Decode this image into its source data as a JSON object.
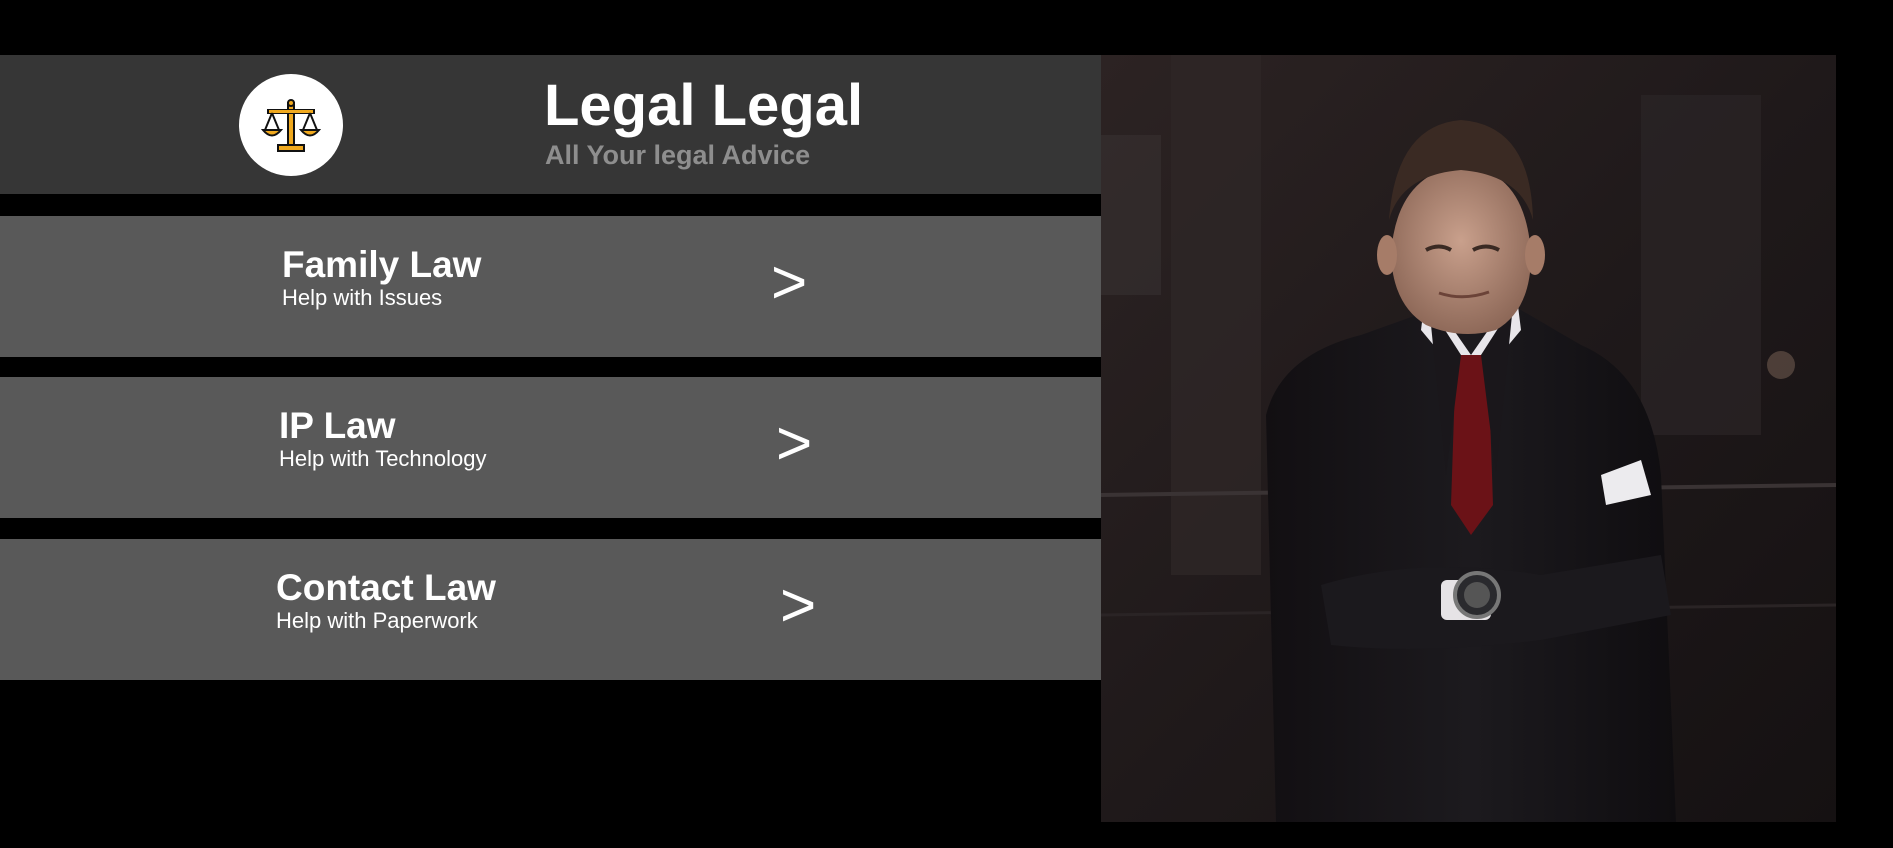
{
  "header": {
    "logo_icon": "scales-of-justice-icon",
    "title": "Legal Legal",
    "subtitle": "All Your legal Advice"
  },
  "services": [
    {
      "title": "Family Law",
      "subtitle": "Help with Issues",
      "arrow": ">"
    },
    {
      "title": "IP Law",
      "subtitle": "Help with Technology",
      "arrow": ">"
    },
    {
      "title": "Contact Law",
      "subtitle": "Help with Paperwork",
      "arrow": ">"
    }
  ],
  "hero_image": {
    "subject": "man-in-suit-photo"
  },
  "colors": {
    "background": "#000000",
    "header_bg": "#363636",
    "card_bg": "#595959",
    "subtitle_gray": "#8e8e8e",
    "logo_gold": "#f0a91e"
  }
}
